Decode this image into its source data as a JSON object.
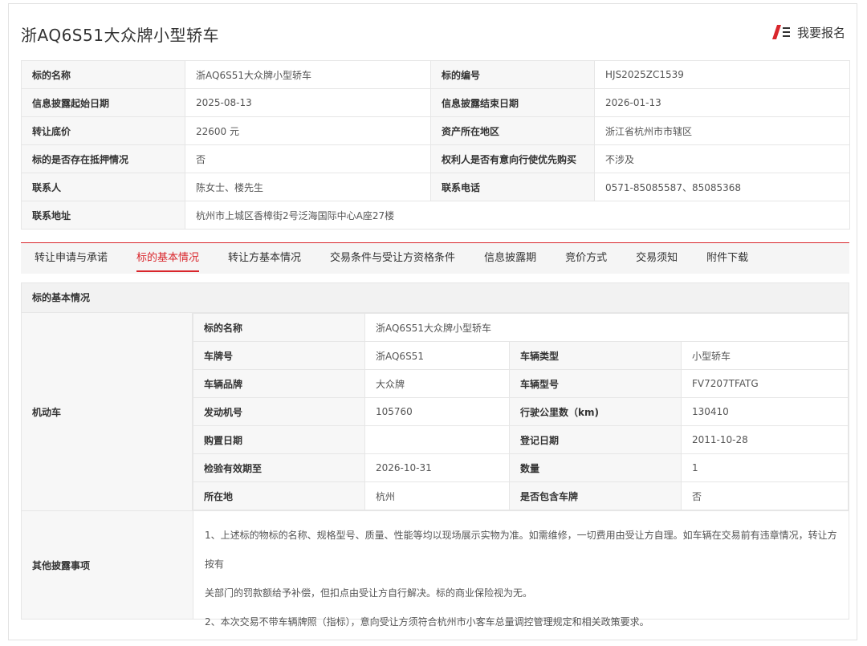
{
  "header": {
    "title": "浙AQ6S51大众牌小型轿车",
    "signup_label": "我要报名",
    "signup_icon": "signup-icon",
    "accent": "#d9262c"
  },
  "info": {
    "rows": [
      [
        {
          "label": "标的名称",
          "value": "浙AQ6S51大众牌小型轿车"
        },
        {
          "label": "标的编号",
          "value": "HJS2025ZC1539"
        }
      ],
      [
        {
          "label": "信息披露起始日期",
          "value": "2025-08-13"
        },
        {
          "label": "信息披露结束日期",
          "value": "2026-01-13"
        }
      ],
      [
        {
          "label": "转让底价",
          "value": "22600 元"
        },
        {
          "label": "资产所在地区",
          "value": "浙江省杭州市市辖区"
        }
      ],
      [
        {
          "label": "标的是否存在抵押情况",
          "value": "否"
        },
        {
          "label": "权利人是否有意向行使优先购买",
          "value": "不涉及"
        }
      ],
      [
        {
          "label": "联系人",
          "value": "陈女士、楼先生"
        },
        {
          "label": "联系电话",
          "value": "0571-85085587、85085368"
        }
      ]
    ],
    "address": {
      "label": "联系地址",
      "value": "杭州市上城区香樟街2号泛海国际中心A座27楼"
    }
  },
  "tabs": {
    "items": [
      "转让申请与承诺",
      "标的基本情况",
      "转让方基本情况",
      "交易条件与受让方资格条件",
      "信息披露期",
      "竞价方式",
      "交易须知",
      "附件下载"
    ],
    "active_index": 1
  },
  "basic": {
    "heading": "标的基本情况",
    "side_label": "机动车",
    "name": {
      "label": "标的名称",
      "value": "浙AQ6S51大众牌小型轿车"
    },
    "rows": [
      [
        {
          "label": "车牌号",
          "value": "浙AQ6S51"
        },
        {
          "label": "车辆类型",
          "value": "小型轿车"
        }
      ],
      [
        {
          "label": "车辆品牌",
          "value": "大众牌"
        },
        {
          "label": "车辆型号",
          "value": "FV7207TFATG"
        }
      ],
      [
        {
          "label": "发动机号",
          "value": "105760"
        },
        {
          "label": "行驶公里数（km)",
          "value": "130410"
        }
      ],
      [
        {
          "label": "购置日期",
          "value": ""
        },
        {
          "label": "登记日期",
          "value": "2011-10-28"
        }
      ],
      [
        {
          "label": "检验有效期至",
          "value": "2026-10-31"
        },
        {
          "label": "数量",
          "value": "1"
        }
      ],
      [
        {
          "label": "所在地",
          "value": "杭州"
        },
        {
          "label": "是否包含车牌",
          "value": "否"
        }
      ]
    ],
    "other": {
      "label": "其他披露事项",
      "line1": "1、上述标的物标的名称、规格型号、质量、性能等均以现场展示实物为准。如需维修，一切费用由受让方自理。如车辆在交易前有违章情况，转让方按有",
      "line2": "关部门的罚款额给予补偿，但扣点由受让方自行解决。标的商业保险视为无。",
      "line3": "2、本次交易不带车辆牌照（指标），意向受让方须符合杭州市小客车总量调控管理规定和相关政策要求。"
    }
  }
}
